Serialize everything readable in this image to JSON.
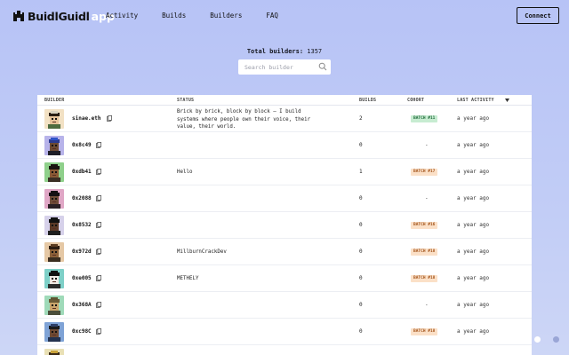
{
  "brand": {
    "name": "BuidlGuidl",
    "suffix": "app"
  },
  "nav": {
    "links": [
      "Activity",
      "Builds",
      "Builders",
      "FAQ"
    ],
    "connect_label": "Connect"
  },
  "summary": {
    "total_label": "Total builders:",
    "total_value": "1357"
  },
  "search": {
    "placeholder": "Search builder"
  },
  "table": {
    "headers": {
      "builder": "BUILDER",
      "status": "STATUS",
      "builds": "BUILDS",
      "cohort": "COHORT",
      "last_activity": "LAST ACTIVITY"
    },
    "rows": [
      {
        "address": "sinae.eth",
        "status": [
          "Brick by brick, block by block — I build",
          "systems where people own their voice, their",
          "value, their world."
        ],
        "builds": "2",
        "cohort": "BATCH #11",
        "cohort_kind": "green",
        "activity": "a year ago",
        "avatar": {
          "bg": "#f2e1c4",
          "skin": "#e6c39a",
          "hair": "#2a1d12",
          "shirt": "#4d6b3f",
          "hat": "#d9d2bf"
        }
      },
      {
        "address": "0x8c49",
        "status": [],
        "builds": "0",
        "cohort": "-",
        "cohort_kind": "none",
        "activity": "a year ago",
        "avatar": {
          "bg": "#b7b3ea",
          "skin": "#6d4a33",
          "hair": "#2b3a8f",
          "shirt": "#1d1d27",
          "hat": "#3053c9"
        }
      },
      {
        "address": "0xdb41",
        "status": [
          "Hello"
        ],
        "builds": "1",
        "cohort": "BATCH #17",
        "cohort_kind": "orange",
        "activity": "a year ago",
        "avatar": {
          "bg": "#8fd08b",
          "skin": "#8a5a35",
          "hair": "#1b1410",
          "shirt": "#3b2f25",
          "hat": "#1b1410"
        }
      },
      {
        "address": "0x2088",
        "status": [],
        "builds": "0",
        "cohort": "-",
        "cohort_kind": "none",
        "activity": "a year ago",
        "avatar": {
          "bg": "#e0a7c6",
          "skin": "#6f4c38",
          "hair": "#151013",
          "shirt": "#2a2024",
          "hat": "#151013"
        }
      },
      {
        "address": "0x8532",
        "status": [],
        "builds": "0",
        "cohort": "BATCH #16",
        "cohort_kind": "orange",
        "activity": "a year ago",
        "avatar": {
          "bg": "#d6d1ea",
          "skin": "#5b3a28",
          "hair": "#121212",
          "shirt": "#1e1e1e",
          "hat": "#121212"
        }
      },
      {
        "address": "0x972d",
        "status": [
          "MillburnCrackDev"
        ],
        "builds": "0",
        "cohort": "BATCH #18",
        "cohort_kind": "orange",
        "activity": "a year ago",
        "avatar": {
          "bg": "#e5c8a5",
          "skin": "#8b6038",
          "hair": "#2a1b10",
          "shirt": "#3a2d20",
          "hat": "#5c3d22"
        }
      },
      {
        "address": "0xe005",
        "status": [
          "METHELY"
        ],
        "builds": "0",
        "cohort": "BATCH #18",
        "cohort_kind": "orange",
        "activity": "a year ago",
        "avatar": {
          "bg": "#7ed0c8",
          "skin": "#f0e9e4",
          "hair": "#111111",
          "shirt": "#2c2c2c",
          "hat": "#111111"
        }
      },
      {
        "address": "0x368A",
        "status": [],
        "builds": "0",
        "cohort": "-",
        "cohort_kind": "none",
        "activity": "a year ago",
        "avatar": {
          "bg": "#9fdab9",
          "skin": "#c9a46b",
          "hair": "#6a5a36",
          "shirt": "#4b4e3a",
          "hat": "#5f5532"
        }
      },
      {
        "address": "0xc98C",
        "status": [],
        "builds": "0",
        "cohort": "BATCH #18",
        "cohort_kind": "orange",
        "activity": "a year ago",
        "avatar": {
          "bg": "#7fa3d6",
          "skin": "#6e4a33",
          "hair": "#1a1a1a",
          "shirt": "#23324f",
          "hat": "#2e3f66"
        }
      },
      {
        "address": "",
        "status": [],
        "builds": "",
        "cohort": "",
        "cohort_kind": "blank",
        "activity": "",
        "avatar": {
          "bg": "#e9e0b5",
          "skin": "#d8b77a",
          "hair": "#3b2a17",
          "shirt": "#4a3a20",
          "hat": "#c9a23a"
        }
      }
    ]
  },
  "colors": {
    "cohort_green_bg": "#c7ecd1",
    "cohort_green_fg": "#1f6b3a",
    "cohort_orange_bg": "#fbe0c7",
    "cohort_orange_fg": "#a3541b",
    "brand_app": "#ffffff"
  },
  "pagination": {
    "dots": 2,
    "active": 0
  }
}
